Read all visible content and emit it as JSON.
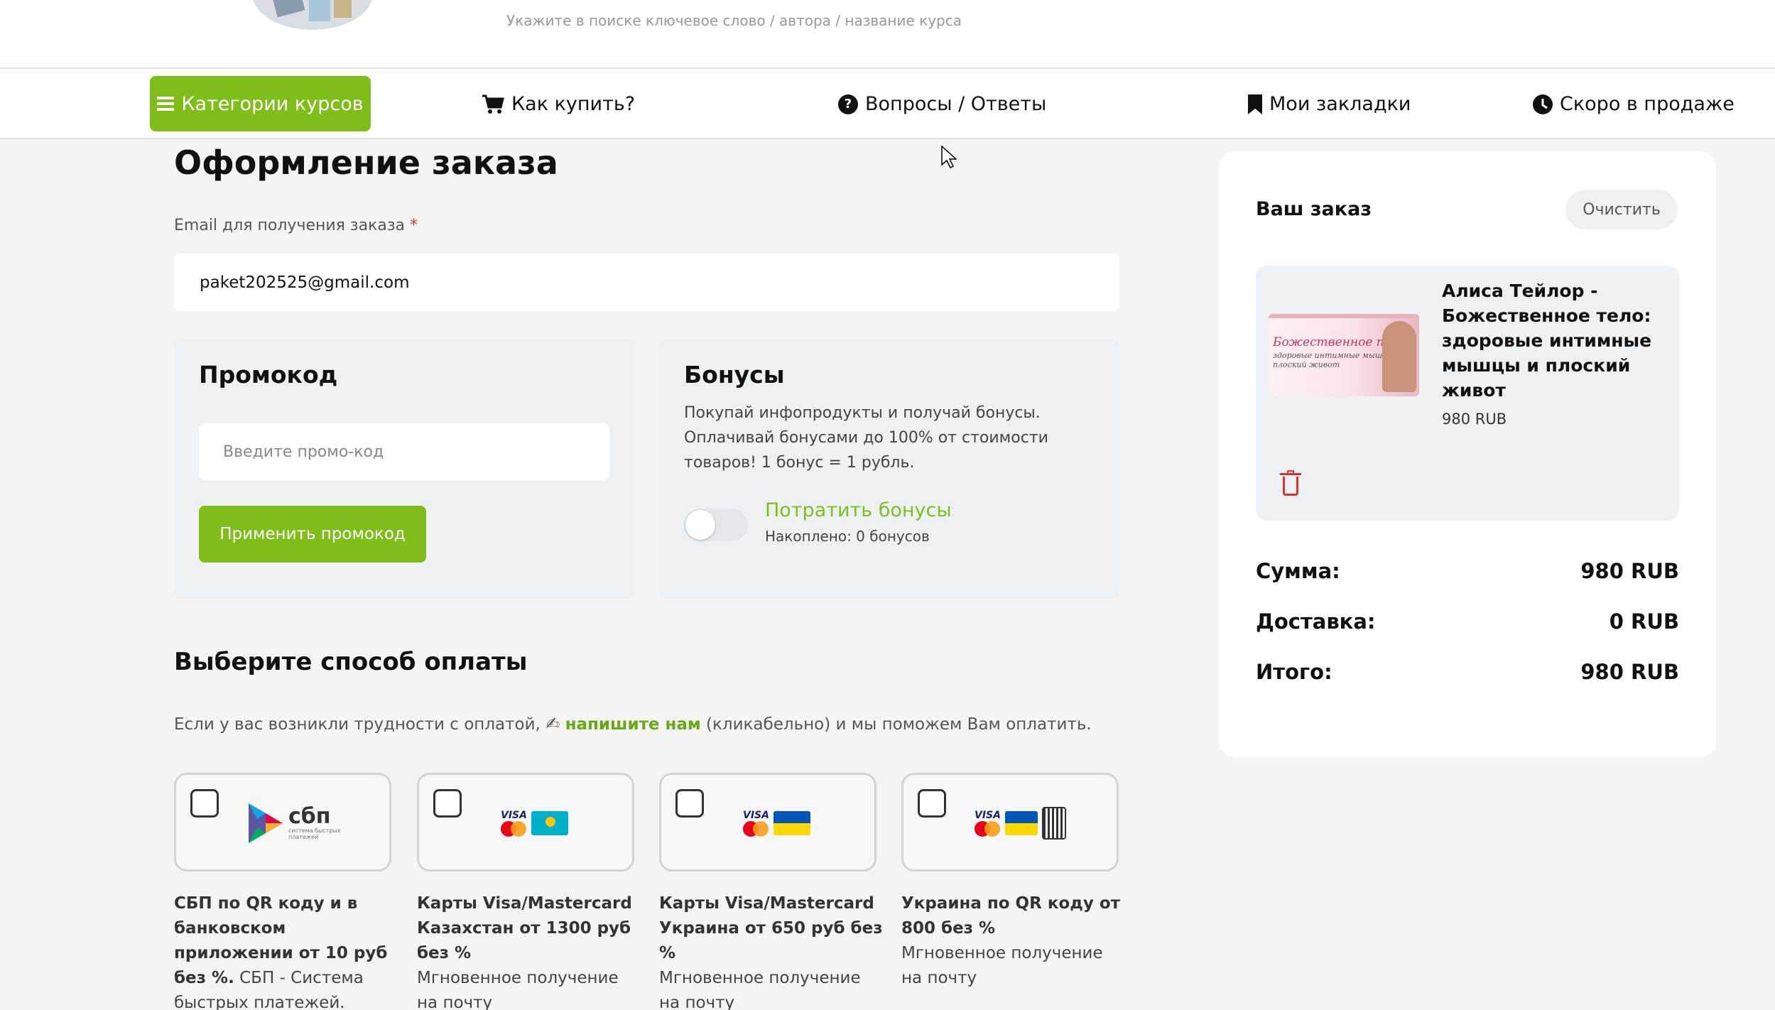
{
  "header": {
    "search_hint": "Укажите в поиске ключевое слово / автора / название курса"
  },
  "nav": {
    "categories": "Категории курсов",
    "how_to_buy": "Как купить?",
    "faq": "Вопросы / Ответы",
    "bookmarks": "Мои закладки",
    "coming_soon": "Скоро в продаже",
    "icons": [
      "menu-icon",
      "cart-icon",
      "question-icon",
      "bookmark-icon",
      "clock-icon"
    ]
  },
  "checkout": {
    "title": "Оформление заказа",
    "email_label": "Email для получения заказа",
    "email_required_mark": "*",
    "email_value": "paket202525@gmail.com"
  },
  "promo": {
    "title": "Промокод",
    "placeholder": "Введите промо-код",
    "apply_label": "Применить промокод"
  },
  "bonus": {
    "title": "Бонусы",
    "description": "Покупай инфопродукты и получай бонусы. Оплачивай бонусами до 100% от стоимости товаров! 1 бонус = 1 рубль.",
    "spend_label": "Потратить бонусы",
    "accumulated": "Накоплено: 0 бонусов",
    "toggle_on": false
  },
  "payment": {
    "title": "Выберите способ оплаты",
    "hint_before": "Если у вас возникли трудности с оплатой,",
    "hint_link": "напишите нам",
    "hint_after": "(кликабельно) и мы поможем Вам оплатить.",
    "methods": [
      {
        "logo": "sbp-logo",
        "logo_text": "сбп",
        "logo_subtext": "система быстрых платежей",
        "title": "СБП по QR коду и в банковском приложении от 10 руб без %.",
        "desc": "СБП - Система быстрых платежей. Мгновенное"
      },
      {
        "logo": "visa-mastercard-kz-logo",
        "logo_text": "VISA",
        "title": "Карты Visa/Mastercard Казахстан от 1300 руб без %",
        "desc": "Мгновенное получение на почту"
      },
      {
        "logo": "visa-mastercard-ua-logo",
        "logo_text": "VISA",
        "title": "Карты Visa/Mastercard Украина от 650 руб без %",
        "desc": "Мгновенное получение на почту"
      },
      {
        "logo": "visa-mastercard-ua-qr-logo",
        "logo_text": "VISA",
        "title": "Украина по QR коду от 800 без %",
        "desc": "Мгновенное получение на почту"
      }
    ]
  },
  "order": {
    "title": "Ваш заказ",
    "clear_label": "Очистить",
    "item": {
      "image_title": "Божественное тело",
      "image_subtitle": "здоровые интимные мышцы и плоский живот",
      "name": "Алиса Тейлор - Божественное тело: здоровые интимные мышцы и плоский живот",
      "price": "980 RUB"
    },
    "sum_label": "Сумма:",
    "sum_value": "980 RUB",
    "delivery_label": "Доставка:",
    "delivery_value": "0 RUB",
    "total_label": "Итого:",
    "total_value": "980 RUB"
  },
  "colors": {
    "accent": "#7fbe1a",
    "danger": "#e03131",
    "panel": "#eef1f4"
  }
}
